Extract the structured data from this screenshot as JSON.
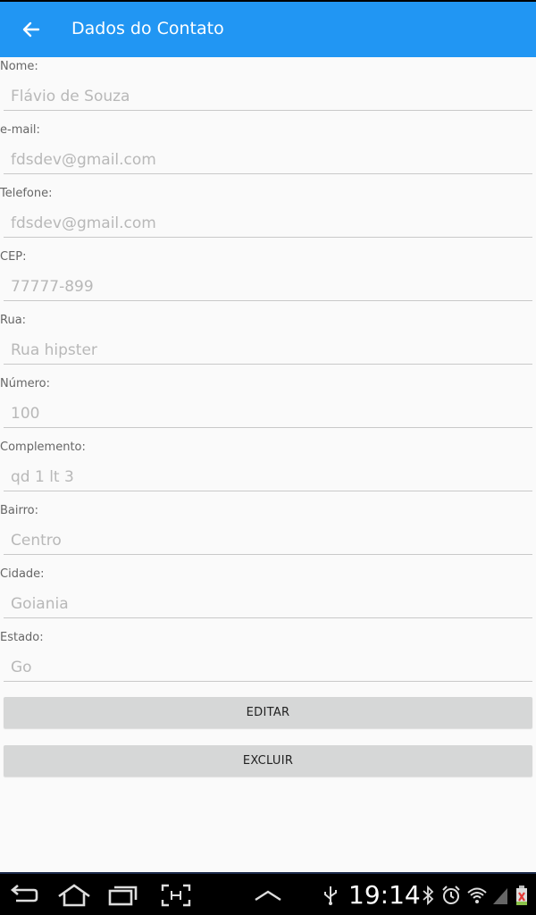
{
  "appbar": {
    "title": "Dados do Contato"
  },
  "fields": [
    {
      "label": "Nome:",
      "value": "Flávio de Souza"
    },
    {
      "label": "e-mail:",
      "value": "fdsdev@gmail.com"
    },
    {
      "label": "Telefone:",
      "value": "fdsdev@gmail.com"
    },
    {
      "label": "CEP:",
      "value": "77777-899"
    },
    {
      "label": "Rua:",
      "value": "Rua hipster"
    },
    {
      "label": "Número:",
      "value": "100"
    },
    {
      "label": "Complemento:",
      "value": "qd 1 lt 3"
    },
    {
      "label": "Bairro:",
      "value": "Centro"
    },
    {
      "label": "Cidade:",
      "value": "Goiania"
    },
    {
      "label": "Estado:",
      "value": "Go"
    }
  ],
  "actions": {
    "edit_label": "EDITAR",
    "delete_label": "EXCLUIR"
  },
  "systembar": {
    "time": "19:14",
    "icons": [
      "back-icon",
      "home-icon",
      "recent-apps-icon",
      "screenshot-icon",
      "chevron-up-icon",
      "usb-icon",
      "bluetooth-icon",
      "alarm-icon",
      "wifi-icon",
      "signal-icon",
      "battery-icon"
    ]
  },
  "colors": {
    "appbar": "#2196f3",
    "button": "#d6d7d7",
    "background": "#fafafa",
    "navbar": "#000000"
  }
}
